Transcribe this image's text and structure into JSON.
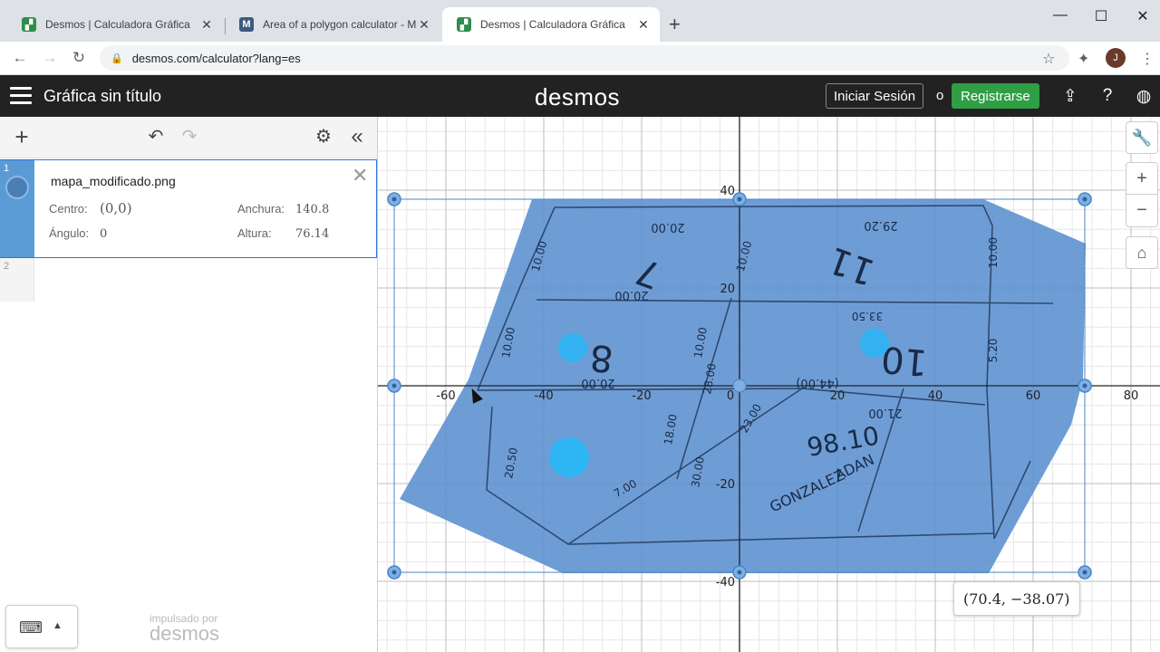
{
  "browser": {
    "tabs": [
      {
        "title": "Desmos | Calculadora Gráfica",
        "icon": "desmos-favicon"
      },
      {
        "title": "Area of a polygon calculator - Ma",
        "icon": "m-favicon"
      },
      {
        "title": "Desmos | Calculadora Gráfica",
        "icon": "desmos-favicon"
      }
    ],
    "url": "desmos.com/calculator?lang=es",
    "profile_initial": "J"
  },
  "header": {
    "title": "Gráfica sin título",
    "logo": "desmos",
    "signin": "Iniciar Sesión",
    "or": "o",
    "register": "Registrarse",
    "register_color": "#2f9e44"
  },
  "expressions": [
    {
      "index": "1",
      "filename": "mapa_modificado.png",
      "center_label": "Centro:",
      "center_value": "(0,0)",
      "width_label": "Anchura:",
      "width_value": "140.8",
      "angle_label": "Ángulo:",
      "angle_value": "0",
      "height_label": "Altura:",
      "height_value": "76.14"
    },
    {
      "index": "2"
    }
  ],
  "powered_by": {
    "small": "impulsado por",
    "brand": "desmos"
  },
  "graph": {
    "x_ticks": [
      "-60",
      "-40",
      "-20",
      "0",
      "20",
      "40",
      "60",
      "80"
    ],
    "y_ticks": [
      "40",
      "20",
      "-20",
      "-40"
    ],
    "coordinate_label": "(70.4, −38.07)",
    "image_color": "#5a8fd0",
    "handle_color": "#4a86c8",
    "map_text": [
      "20.00",
      "29.20",
      "10.00",
      "10.00",
      "7",
      "11",
      "10.00",
      "20.00",
      "33.50",
      "8",
      "10",
      "10.00",
      "10.00",
      "5.20",
      "20.00",
      "(44.00)",
      "28.00",
      "23.00",
      "21.00",
      "18.00",
      "98.10",
      "20.50",
      "30.00",
      "ADAN",
      "GONZALEZ",
      "7.00"
    ]
  }
}
